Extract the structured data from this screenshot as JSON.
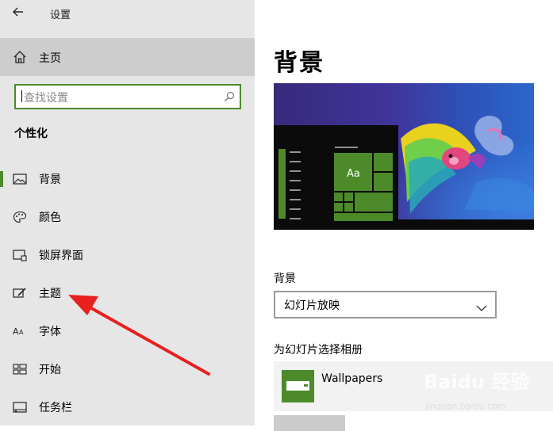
{
  "app": {
    "title": "设置",
    "back_icon": "back-arrow-icon"
  },
  "sidebar": {
    "home_label": "主页",
    "search_placeholder": "查找设置",
    "section_title": "个性化",
    "items": [
      {
        "label": "背景",
        "icon": "picture-icon",
        "selected": true
      },
      {
        "label": "颜色",
        "icon": "palette-icon",
        "selected": false
      },
      {
        "label": "锁屏界面",
        "icon": "lock-screen-icon",
        "selected": false
      },
      {
        "label": "主题",
        "icon": "theme-brush-icon",
        "selected": false
      },
      {
        "label": "字体",
        "icon": "font-icon",
        "selected": false
      },
      {
        "label": "开始",
        "icon": "start-icon",
        "selected": false
      },
      {
        "label": "任务栏",
        "icon": "taskbar-icon",
        "selected": false
      }
    ]
  },
  "main": {
    "page_title": "背景",
    "preview": {
      "tile_label": "Aa"
    },
    "background_label": "背景",
    "background_value": "幻灯片放映",
    "album_label": "为幻灯片选择相册",
    "album_name": "Wallpapers"
  },
  "watermark": {
    "text": "Baidu 经验",
    "sub": "jingyan.baidu.com"
  },
  "colors": {
    "accent": "#4c8a2a",
    "sidebar_bg": "#e6e6e6",
    "arrow": "#e8201e"
  }
}
